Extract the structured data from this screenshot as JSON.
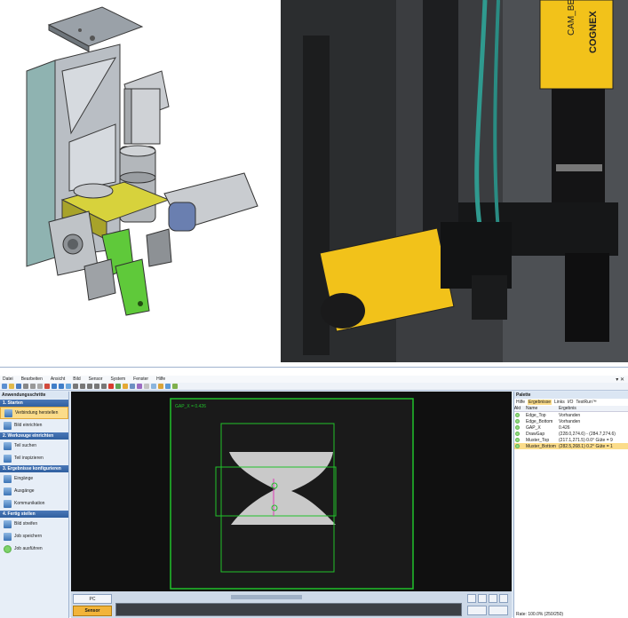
{
  "app": {
    "title": "",
    "menu": [
      "Datei",
      "Bearbeiten",
      "Ansicht",
      "Bild",
      "Sensor",
      "System",
      "Fenster",
      "Hilfe"
    ]
  },
  "sidebar": {
    "title": "Anwendungsschritte",
    "sections": [
      {
        "title": "1. Starten",
        "items": [
          {
            "label": "Verbindung herstellen",
            "selected": true
          },
          {
            "label": "Bild einrichten",
            "selected": false
          }
        ]
      },
      {
        "title": "2. Werkzeuge einrichten",
        "items": [
          {
            "label": "Teil suchen"
          },
          {
            "label": "Teil inspizieren"
          }
        ]
      },
      {
        "title": "3. Ergebnisse konfigurieren",
        "items": [
          {
            "label": "Eingänge"
          },
          {
            "label": "Ausgänge"
          },
          {
            "label": "Kommunikation"
          }
        ]
      },
      {
        "title": "4. Fertig stellen",
        "items": [
          {
            "label": "Bild streifen"
          },
          {
            "label": "Job speichern"
          },
          {
            "label": "Job ausführen",
            "done": true
          }
        ]
      }
    ]
  },
  "viewer": {
    "overlay_label": "GAP_X = 0.426"
  },
  "bottom": {
    "pc_label": "PC",
    "sensor_label": "Sensor"
  },
  "palette": {
    "title": "Palette",
    "tabs": [
      "Hilfe",
      "Ergebnisse",
      "Links",
      "I/O",
      "TestRun™"
    ],
    "active_tab": "Ergebnisse",
    "columns": [
      "Akt",
      "Name",
      "Ergebnis"
    ],
    "rows": [
      {
        "name": "Edge_Top",
        "result": "Vorhanden"
      },
      {
        "name": "Edge_Bottom",
        "result": "Vorhanden"
      },
      {
        "name": "GAP_X",
        "result": "0.426"
      },
      {
        "name": "DrawGap",
        "result": "(228.0,274.6) - (284.7,274.6)"
      },
      {
        "name": "Muster_Top",
        "result": "(217.1,271.5) 0.0° Güte = 9"
      },
      {
        "name": "Muster_Bottom",
        "result": "(282.5,268.1) 0.2° Güte = 1"
      }
    ],
    "selected_row": 5
  },
  "status": {
    "rate_text": "Rate: 100.0% (250/250)"
  },
  "colors": {
    "accent": "#2f5f9f",
    "selection": "#fbdc8a",
    "overlay_green": "#21c12b",
    "camera_yellow": "#f2c21a"
  }
}
